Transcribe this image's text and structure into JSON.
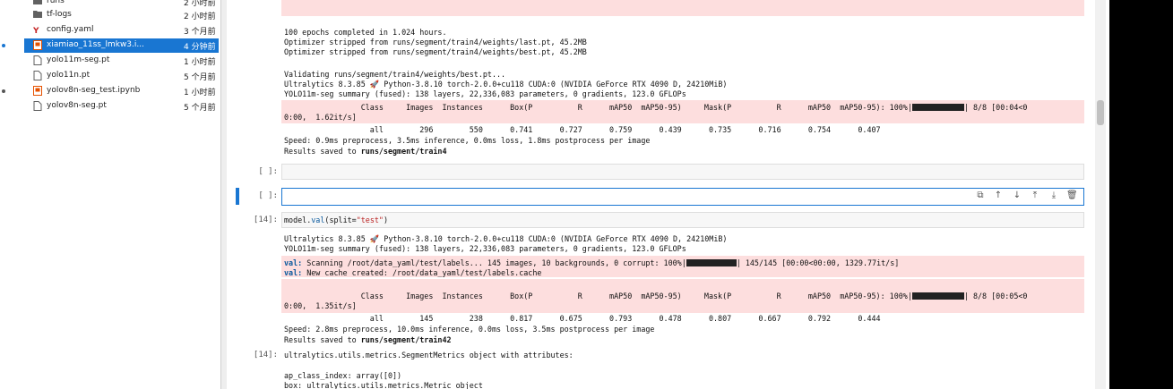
{
  "files": [
    {
      "name": "runs",
      "time": "2 小时前",
      "icon": "folder-icon",
      "selected": false
    },
    {
      "name": "tf-logs",
      "time": "2 小时前",
      "icon": "folder-icon",
      "selected": false
    },
    {
      "name": "config.yaml",
      "time": "3 个月前",
      "icon": "yaml-icon",
      "selected": false
    },
    {
      "name": "xiamiao_11ss_lmkw3.i...",
      "time": "4 分钟前",
      "icon": "notebook-icon",
      "selected": true
    },
    {
      "name": "yolo11m-seg.pt",
      "time": "1 小时前",
      "icon": "file-icon",
      "selected": false
    },
    {
      "name": "yolo11n.pt",
      "time": "5 个月前",
      "icon": "file-icon",
      "selected": false
    },
    {
      "name": "yolov8n-seg_test.ipynb",
      "time": "1 小时前",
      "icon": "notebook-icon",
      "selected": false
    },
    {
      "name": "yolov8n-seg.pt",
      "time": "5 个月前",
      "icon": "file-icon",
      "selected": false
    }
  ],
  "output1": {
    "l1": "100 epochs completed in 1.024 hours.",
    "l2": "Optimizer stripped from runs/segment/train4/weights/last.pt, 45.2MB",
    "l3": "Optimizer stripped from runs/segment/train4/weights/best.pt, 45.2MB",
    "l4": "Validating runs/segment/train4/weights/best.pt...",
    "l5": "Ultralytics 8.3.85 🚀 Python-3.8.10 torch-2.0.0+cu118 CUDA:0 (NVIDIA GeForce RTX 4090 D, 24210MiB)",
    "l6": "YOLO11m-seg summary (fused): 138 layers, 22,336,083 parameters, 0 gradients, 123.0 GFLOPs",
    "hdr": "                 Class     Images  Instances      Box(P          R      mAP50  mAP50-95)     Mask(P          R      mAP50  mAP50-95): 100%|",
    "hdr_tail": "| 8/8 [00:04<0",
    "hdr2": "0:00,  1.62it/s]",
    "all": "                   all        296        550      0.741      0.727      0.759      0.439      0.735      0.716      0.754      0.407",
    "speed": "Speed: 0.9ms preprocess, 3.5ms inference, 0.0ms loss, 1.8ms postprocess per image",
    "saved_prefix": "Results saved to ",
    "saved_path": "runs/segment/train4"
  },
  "cell_empty1": {
    "prompt": "[ ]:"
  },
  "cell_active": {
    "prompt": "[ ]:"
  },
  "cell14": {
    "prompt": "[14]:",
    "code_obj": "model.",
    "code_fn": "val",
    "code_open": "(split=",
    "code_str": "\"test\"",
    "code_close": ")"
  },
  "output2": {
    "l1": "Ultralytics 8.3.85 🚀 Python-3.8.10 torch-2.0.0+cu118 CUDA:0 (NVIDIA GeForce RTX 4090 D, 24210MiB)",
    "l2": "YOLO11m-seg summary (fused): 138 layers, 22,336,083 parameters, 0 gradients, 123.0 GFLOPs",
    "scan_kw": "val:",
    "scan": " Scanning /root/data_yaml/test/labels... 145 images, 10 backgrounds, 0 corrupt: 100%|",
    "scan_tail": "| 145/145 [00:00<00:00, 1329.77it/s]",
    "cache_kw": "val:",
    "cache": " New cache created: /root/data_yaml/test/labels.cache",
    "hdr": "                 Class     Images  Instances      Box(P          R      mAP50  mAP50-95)     Mask(P          R      mAP50  mAP50-95): 100%|",
    "hdr_tail": "| 8/8 [00:05<0",
    "hdr2": "0:00,  1.35it/s]",
    "all": "                   all        145        238      0.817      0.675      0.793      0.478      0.807      0.667      0.792      0.444",
    "speed": "Speed: 2.8ms preprocess, 10.0ms inference, 0.0ms loss, 3.5ms postprocess per image",
    "saved_prefix": "Results saved to ",
    "saved_path": "runs/segment/train42"
  },
  "result": {
    "prompt": "[14]:",
    "l1": "ultralytics.utils.metrics.SegmentMetrics object with attributes:",
    "l2": "ap_class_index: array([0])",
    "l3": "box: ultralytics.utils.metrics.Metric object"
  }
}
